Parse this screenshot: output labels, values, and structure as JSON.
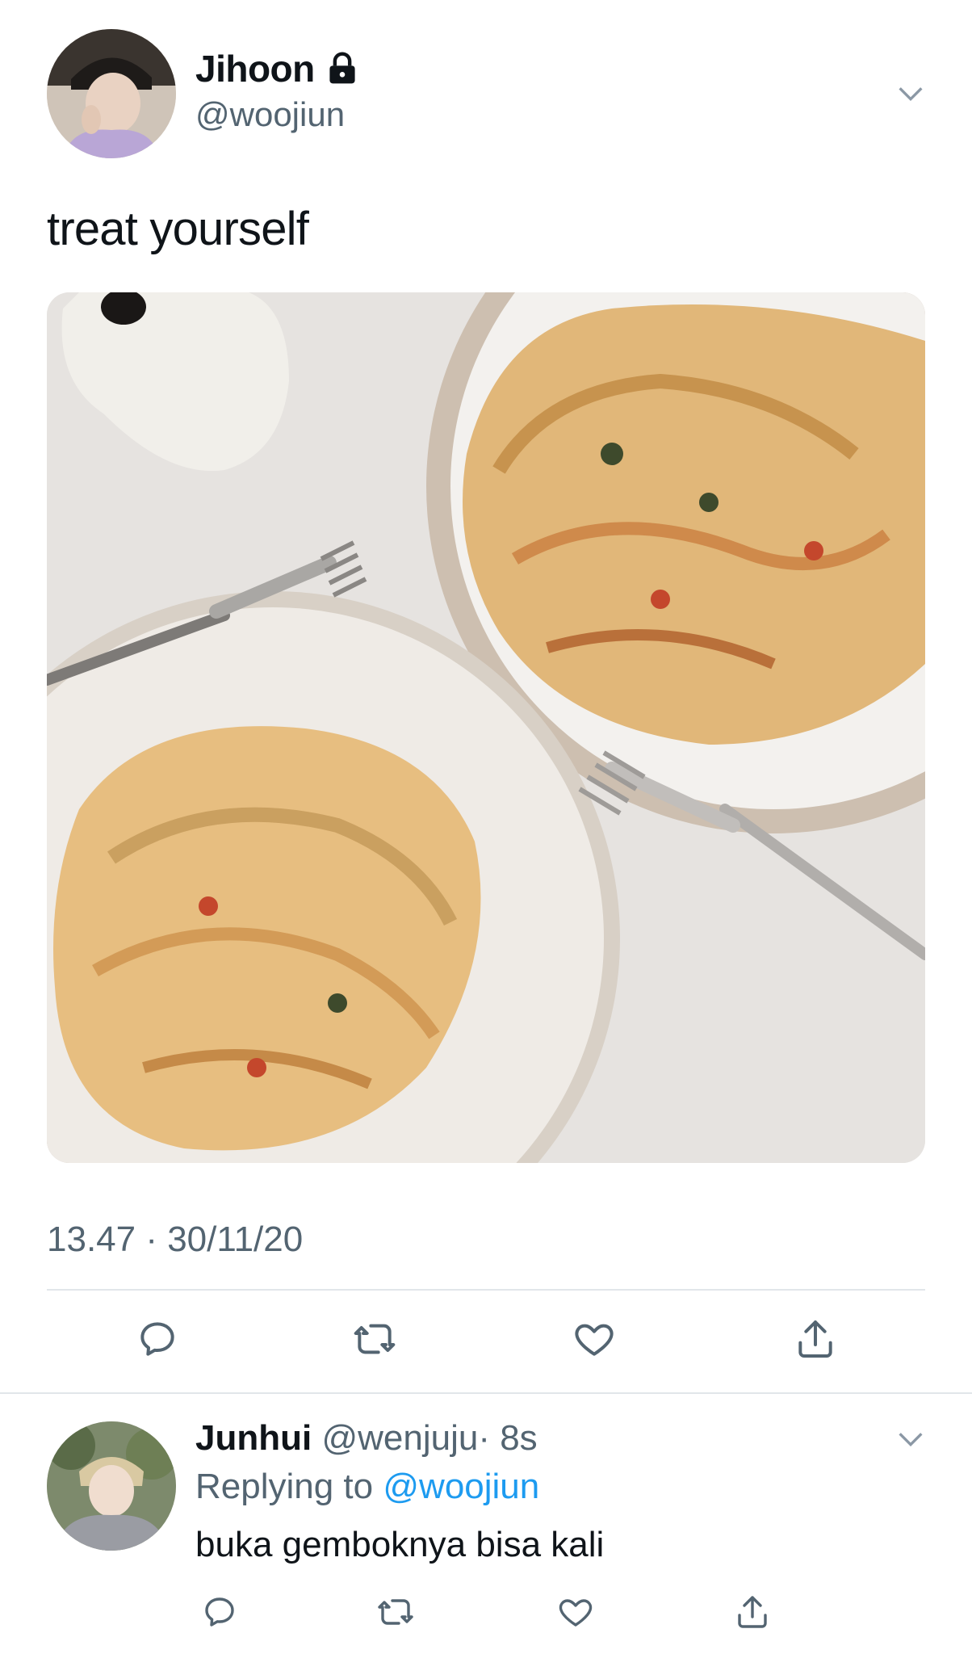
{
  "tweet": {
    "display_name": "Jihoon",
    "handle": "@woojiun",
    "protected_icon": "lock-icon",
    "more_icon": "chevron-down-icon",
    "text": "treat yourself",
    "photo_alt": "two plates of pasta with forks",
    "timestamp": "13.47 · 30/11/20",
    "actions": [
      {
        "name": "reply",
        "icon": "reply-icon"
      },
      {
        "name": "retweet",
        "icon": "retweet-icon"
      },
      {
        "name": "like",
        "icon": "heart-icon"
      },
      {
        "name": "share",
        "icon": "share-icon"
      }
    ]
  },
  "reply": {
    "display_name": "Junhui",
    "handle": "@wenjuju",
    "time": "· 8s",
    "replying_prefix": "Replying to",
    "replying_to": "@woojiun",
    "text": "buka gemboknya bisa kali",
    "more_icon": "chevron-down-icon"
  },
  "colors": {
    "text_primary": "#0f1419",
    "text_secondary": "#536471",
    "link": "#1d9bf0",
    "divider": "#e1e6ea"
  }
}
